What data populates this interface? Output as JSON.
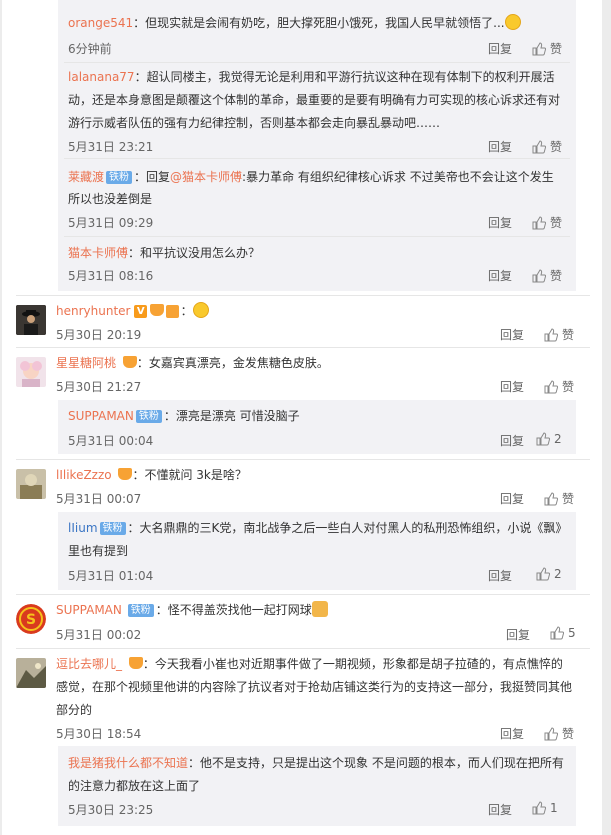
{
  "labels": {
    "reply": "回复",
    "like": "赞"
  },
  "comments": [
    {
      "name": "orange541",
      "text": "：但现实就是会闹有奶吃，胆大撑死胆小饿死，我国人民早就领悟了...",
      "time": "6分钟前",
      "like": "赞"
    },
    {
      "name": "lalanana77",
      "text1": "：超认同楼主，我觉得无论是利用和平游行抗议这种在现有体制下的权利开展活",
      "text2": "动，还是本身意图是颠覆这个体制的革命，最重要的是要有明确有力可实现的核心诉求还有对",
      "text3": "游行示威者队伍的强有力纪律控制，否则基本都会走向暴乱暴动吧……",
      "time": "5月31日 23:21",
      "like": "赞"
    },
    {
      "name": "莱藏渡",
      "badge": "铁粉",
      "text1a": "：回复",
      "mention": "@猫本卡师傅",
      "text1b": ":暴力革命 有组织纪律核心诉求 不过美帝也不会让这个发生",
      "text2": "所以也没差倒是",
      "time": "5月31日 09:29",
      "like": "赞"
    },
    {
      "name": "猫本卡师傅",
      "text": "：和平抗议没用怎么办？",
      "time": "5月31日 08:16",
      "like": "赞"
    },
    {
      "name": "henryhunter",
      "verified": "V",
      "time": "5月30日 20:19",
      "like": "赞"
    },
    {
      "name": "星星糖阿桃",
      "text": "：女嘉宾真漂亮，金发焦糖色皮肤。",
      "time": "5月30日 21:27",
      "like": "赞"
    },
    {
      "name": "SUPPAMAN",
      "badge": "铁粉",
      "text": "：漂亮是漂亮 可惜没脑子",
      "time": "5月31日 00:04",
      "like": "2"
    },
    {
      "name": "lIlikeZzzo",
      "text": "：不懂就问 3k是啥？",
      "time": "5月31日 00:07",
      "like": "赞"
    },
    {
      "name": "lIium",
      "badge": "铁粉",
      "text1": "：大名鼎鼎的三K党，南北战争之后一些白人对付黑人的私刑恐怖组织，小说《飘》",
      "text2": "里也有提到",
      "time": "5月31日 01:04",
      "like": "2"
    },
    {
      "name": "SUPPAMAN",
      "badge": "铁粉",
      "text": "：怪不得盖茨找他一起打网球",
      "time": "5月31日 00:02",
      "like": "5"
    },
    {
      "name": "逗比去哪儿_",
      "text1": "：今天我看小崔也对近期事件做了一期视频，形象都是胡子拉碴的，有点憔悴的",
      "text2": "感觉，在那个视频里他讲的内容除了抗议者对于抢劫店铺这类行为的支持这一部分，我挺赞同其他",
      "text3": "部分的",
      "time": "5月30日 18:54",
      "like": "赞"
    },
    {
      "name": "我是猪我什么都不知道",
      "text1": "：他不是支持，只是提出这个现象 不是问题的根本，而人们现在把所有",
      "text2": "的注意力都放在这上面了",
      "time": "5月30日 23:25",
      "like": "1"
    }
  ]
}
